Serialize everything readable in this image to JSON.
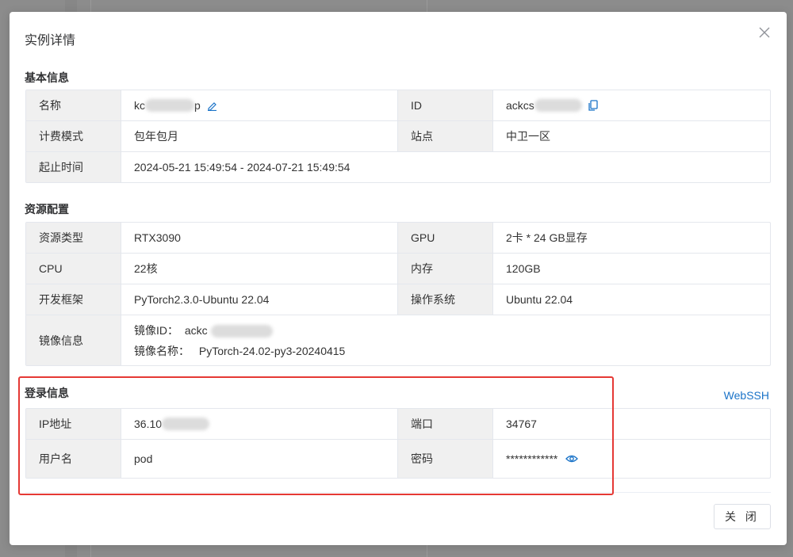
{
  "dialog": {
    "title": "实例详情",
    "close_button": "关 闭"
  },
  "basic": {
    "section_title": "基本信息",
    "name_label": "名称",
    "name_value_prefix": "kc",
    "name_value_suffix": "p",
    "id_label": "ID",
    "id_value_prefix": "ackcs",
    "billing_label": "计费模式",
    "billing_value": "包年包月",
    "site_label": "站点",
    "site_value": "中卫一区",
    "period_label": "起止时间",
    "period_value": "2024-05-21 15:49:54 - 2024-07-21 15:49:54"
  },
  "resource": {
    "section_title": "资源配置",
    "type_label": "资源类型",
    "type_value": "RTX3090",
    "gpu_label": "GPU",
    "gpu_value": "2卡 * 24 GB显存",
    "cpu_label": "CPU",
    "cpu_value": "22核",
    "mem_label": "内存",
    "mem_value": "120GB",
    "framework_label": "开发框架",
    "framework_value": "PyTorch2.3.0-Ubuntu 22.04",
    "os_label": "操作系统",
    "os_value": "Ubuntu 22.04",
    "image_label": "镜像信息",
    "image_id_label": "镜像ID：",
    "image_id_value_prefix": "ackc",
    "image_name_label": "镜像名称：",
    "image_name_value": "PyTorch-24.02-py3-20240415"
  },
  "login": {
    "section_title": "登录信息",
    "webssh_link": "WebSSH",
    "ip_label": "IP地址",
    "ip_value_prefix": "36.10",
    "port_label": "端口",
    "port_value": "34767",
    "user_label": "用户名",
    "user_value": "pod",
    "password_label": "密码",
    "password_value": "************"
  },
  "colors": {
    "accent": "#1a73c8",
    "highlight_border": "#e53935",
    "label_bg": "#f0f0f0"
  },
  "icons": {
    "close": "close-icon",
    "edit": "edit-icon",
    "copy": "copy-icon",
    "eye": "eye-icon"
  }
}
